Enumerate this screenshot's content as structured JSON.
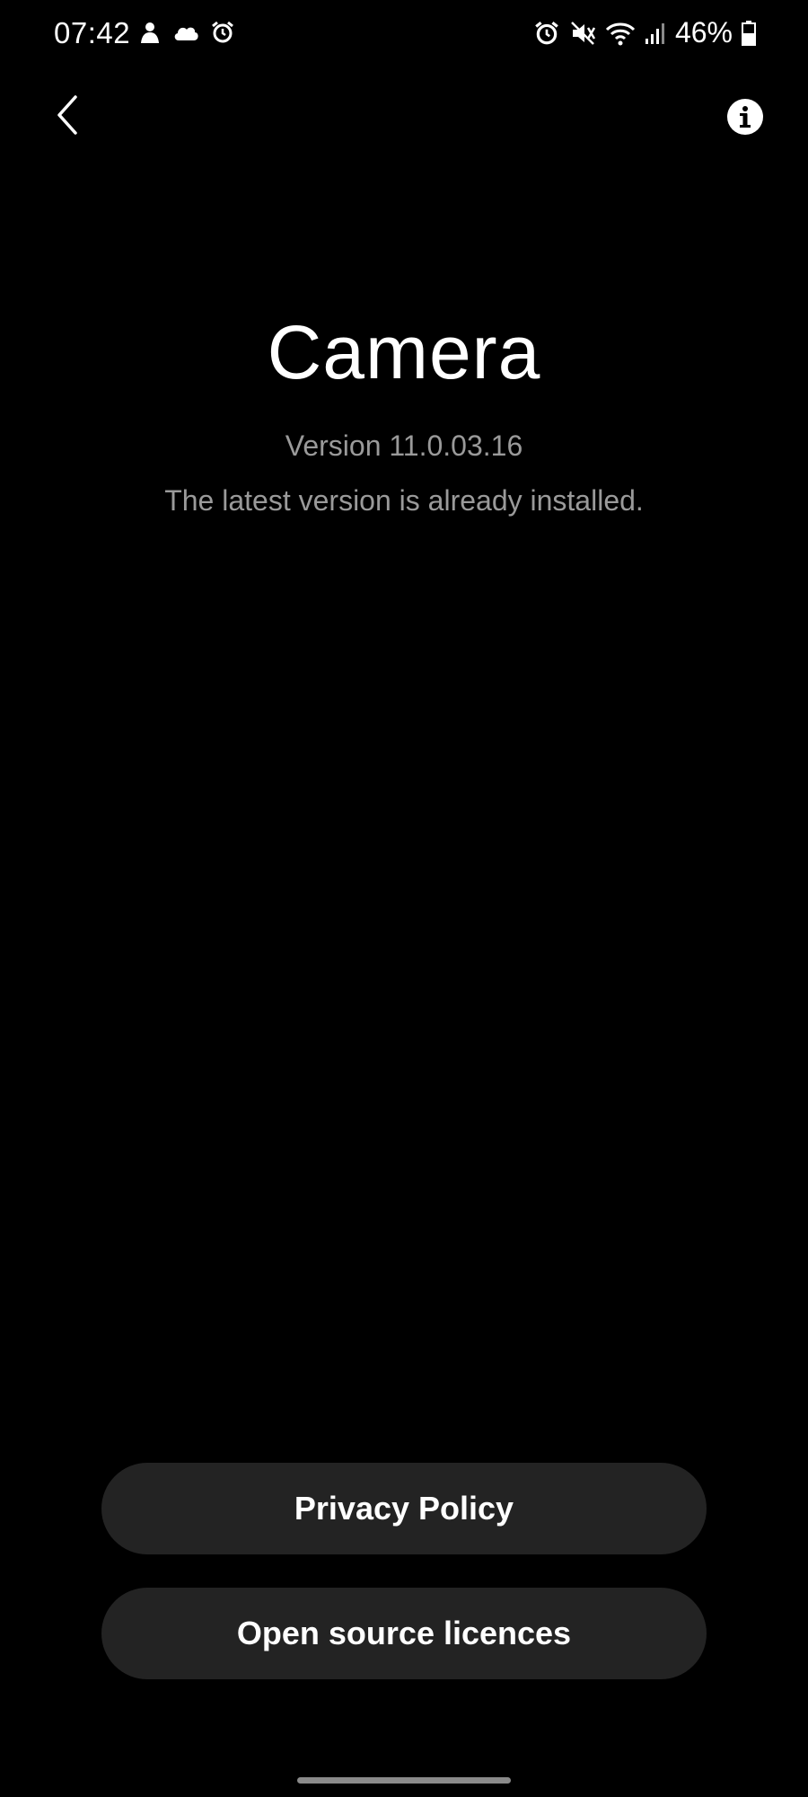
{
  "status_bar": {
    "time": "07:42",
    "left_icons": [
      "person-notification-icon",
      "cloud-icon",
      "alarm-icon"
    ],
    "right_icons": [
      "alarm-icon",
      "mute-icon",
      "wifi-icon",
      "signal-icon"
    ],
    "battery_percent": "46%"
  },
  "top_bar": {
    "back_icon": "back-chevron-icon",
    "info_icon": "info-icon"
  },
  "app": {
    "name": "Camera",
    "version": "Version 11.0.03.16",
    "status": "The latest version is already installed."
  },
  "buttons": {
    "privacy_policy": "Privacy Policy",
    "open_source_licences": "Open source licences"
  },
  "colors": {
    "background": "#000000",
    "text_primary": "#ffffff",
    "text_secondary": "#9a9a9a",
    "button_background": "#232323"
  }
}
